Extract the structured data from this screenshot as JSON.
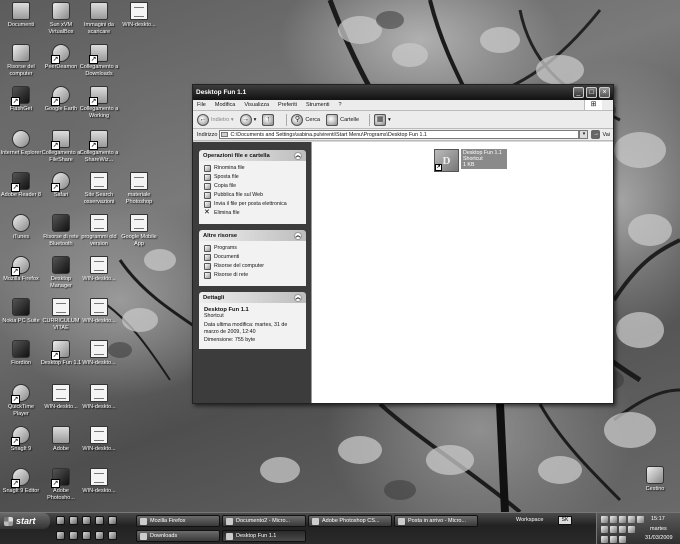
{
  "desktop": {
    "icons": [
      {
        "label": "Documenti"
      },
      {
        "label": "Sun xVM VirtualBox"
      },
      {
        "label": "Immagini da scaricare"
      },
      {
        "label": "WIN-deskto..."
      },
      {
        "label": "Risorse del computer"
      },
      {
        "label": "PeerDeamon"
      },
      {
        "label": "Collegamento a Downloads"
      },
      {
        "label": "FlashGet"
      },
      {
        "label": "Google Earth"
      },
      {
        "label": "Collegamento a Working"
      },
      {
        "label": "Internet Explorer"
      },
      {
        "label": "Collegamento a FileShare"
      },
      {
        "label": "Collegamento a ShareWiz..."
      },
      {
        "label": "Adobe Reader 8"
      },
      {
        "label": "Safari"
      },
      {
        "label": "Site Search osservazioni"
      },
      {
        "label": "materiale Photoshop"
      },
      {
        "label": "iTunes"
      },
      {
        "label": "Risorse di rete Bluetooth"
      },
      {
        "label": "programmi old version"
      },
      {
        "label": "Google Mobile App"
      },
      {
        "label": "Mozilla Firefox"
      },
      {
        "label": "Desktop Manager"
      },
      {
        "label": "WIN-deskto..."
      },
      {
        "label": "Nokia PC Suite"
      },
      {
        "label": "CURRICULUM VITAE"
      },
      {
        "label": "WIN-deskto..."
      },
      {
        "label": "Fiordiön"
      },
      {
        "label": "Desktop Fun 1.1"
      },
      {
        "label": "WIN-deskto..."
      },
      {
        "label": "QuickTime Player"
      },
      {
        "label": "WIN-deskto..."
      },
      {
        "label": "WIN-deskto..."
      },
      {
        "label": "SnagIt 9"
      },
      {
        "label": "Adobe"
      },
      {
        "label": "WIN-deskto..."
      },
      {
        "label": "SnagIt 9 Editor"
      },
      {
        "label": "Adobe Photosho..."
      },
      {
        "label": "WIN-deskto..."
      },
      {
        "label": "Cestino"
      }
    ]
  },
  "window": {
    "title": "Desktop Fun 1.1",
    "menu": [
      "File",
      "Modifica",
      "Visualizza",
      "Preferiti",
      "Strumenti",
      "?"
    ],
    "toolbar": {
      "back": "Indietro",
      "search": "Cerca",
      "folders": "Cartelle"
    },
    "address": {
      "label": "Indirizzo",
      "value": "C:\\Documents and Settings\\sabina.pulvirenti\\Start Menu\\Programs\\Desktop Fun 1.1",
      "go": "Vai"
    },
    "panels": {
      "file_tasks": {
        "title": "Operazioni file e cartella",
        "items": [
          "Rinomina file",
          "Sposta file",
          "Copia file",
          "Pubblica file sul Web",
          "Invia il file per posta elettronica",
          "Elimina file"
        ]
      },
      "other_places": {
        "title": "Altre risorse",
        "items": [
          "Programs",
          "Documenti",
          "Risorse del computer",
          "Risorse di rete"
        ]
      },
      "details": {
        "title": "Dettagli",
        "name": "Desktop Fun 1.1",
        "type": "Shortcut",
        "modified": "Data ultima modifica: martes, 31 de marzo de 2009, 12:40",
        "size": "Dimensione: 755 byte"
      }
    },
    "file": {
      "name": "Desktop Fun 1.1",
      "type": "Shortcut",
      "size": "1 KB",
      "icon_letter": "D"
    }
  },
  "taskbar": {
    "start_label": "start",
    "buttons_row1": [
      "Mozilla Firefox",
      "Documento2 - Micro...",
      "Adobe Photoshop CS...",
      "Posta in arrivo - Micro..."
    ],
    "buttons_row2": [
      "Downloads",
      "Desktop Fun 1.1"
    ],
    "workspace": "Workspace",
    "lang": "SK",
    "clock": {
      "time": "15:17",
      "day": "martes",
      "date": "31/03/2009"
    }
  }
}
